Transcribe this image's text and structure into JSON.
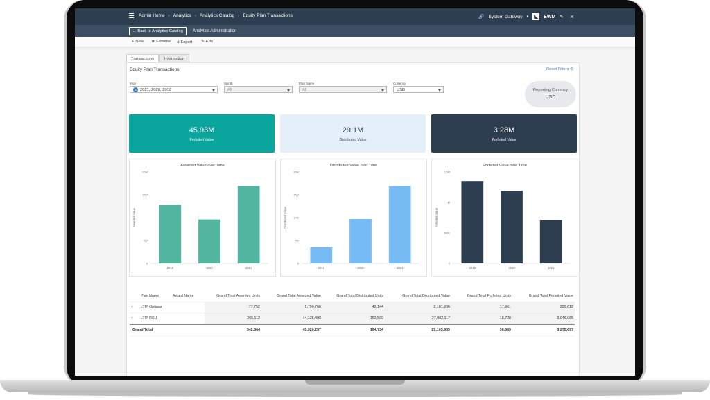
{
  "header": {
    "crumbs": [
      "Admin Home",
      "Analytics",
      "Analytics Catalog",
      "Equity Plan Transactions"
    ],
    "gateway": "System Gateway",
    "user": "EWM",
    "back_label": "Back to Analytics Catalog",
    "admin_label": "Analytics Administration"
  },
  "toolbar": {
    "new": "New",
    "favorite": "Favorite",
    "export": "Export",
    "edit": "Edit"
  },
  "tabs": [
    "Transactions",
    "Information"
  ],
  "panel": {
    "title": "Equity Plan Transactions",
    "reset": "Reset Filters"
  },
  "filters": {
    "year": {
      "label": "Year",
      "count": "3",
      "value": "2021, 2020, 2019"
    },
    "month": {
      "label": "Month",
      "value": "All"
    },
    "plan": {
      "label": "Plan Name",
      "value": "All"
    },
    "currency": {
      "label": "Currency",
      "value": "USD"
    }
  },
  "reporting_currency": {
    "label": "Reporting Currency",
    "value": "USD"
  },
  "kpis": [
    {
      "value": "45.93M",
      "label": "Forfeited Value",
      "bg": "#0aa69d",
      "fg": "#ffffff"
    },
    {
      "value": "29.1M",
      "label": "Distributed Value",
      "bg": "#e4effa",
      "fg": "#2d3e50"
    },
    {
      "value": "3.28M",
      "label": "Forfeited Value",
      "bg": "#2d3e50",
      "fg": "#ffffff"
    }
  ],
  "chart_data": [
    {
      "type": "bar",
      "title": "Awarded Value over Time",
      "ylabel": "Awarded Value",
      "categories": [
        "2019",
        "2020",
        "2021"
      ],
      "values": [
        12.8,
        9.6,
        16.9
      ],
      "ylim": [
        0,
        20
      ],
      "yticks": [
        "0",
        "5M",
        "15M",
        "20M"
      ],
      "ytick_vals": [
        0,
        5,
        15,
        20
      ],
      "color": "#52b5a0"
    },
    {
      "type": "bar",
      "title": "Distributed Value over Time",
      "ylabel": "Distributed Value",
      "categories": [
        "2019",
        "2020",
        "2021"
      ],
      "values": [
        3.5,
        9.7,
        16.9
      ],
      "ylim": [
        0,
        20
      ],
      "yticks": [
        "0",
        "5M",
        "10M",
        "15M",
        "20M"
      ],
      "ytick_vals": [
        0,
        5,
        10,
        15,
        20
      ],
      "color": "#77bbf5"
    },
    {
      "type": "bar",
      "title": "Forfeited Value over Time",
      "ylabel": "Forfeited Value",
      "categories": [
        "2019",
        "2020",
        "2021"
      ],
      "values": [
        1.35,
        1.19,
        0.71
      ],
      "ylim": [
        0,
        1.5
      ],
      "yticks": [
        "0",
        "500K",
        "1M",
        "1.5M"
      ],
      "ytick_vals": [
        0,
        0.5,
        1,
        1.5
      ],
      "color": "#2d3e50"
    }
  ],
  "table": {
    "columns": [
      "Plan Name",
      "Award Name",
      "Grand Total Awarded Units",
      "Grand Total Awarded Value",
      "Grand Total Distributed Units",
      "Grand Total Distributed Value",
      "Grand Total Forfeited Units",
      "Grand Total Forfeited Value"
    ],
    "rows": [
      {
        "plan": "LTIP Options",
        "values": [
          "77,752",
          "1,790,760",
          "42,144",
          "2,101,836",
          "17,961",
          "229,612"
        ]
      },
      {
        "plan": "LTIP RSU",
        "values": [
          "265,112",
          "44,135,498",
          "152,590",
          "27,002,117",
          "18,728",
          "3,046,085"
        ]
      }
    ],
    "total": {
      "label": "Grand Total",
      "values": [
        "342,864",
        "45,926,257",
        "194,734",
        "29,103,953",
        "36,689",
        "3,275,697"
      ]
    }
  }
}
